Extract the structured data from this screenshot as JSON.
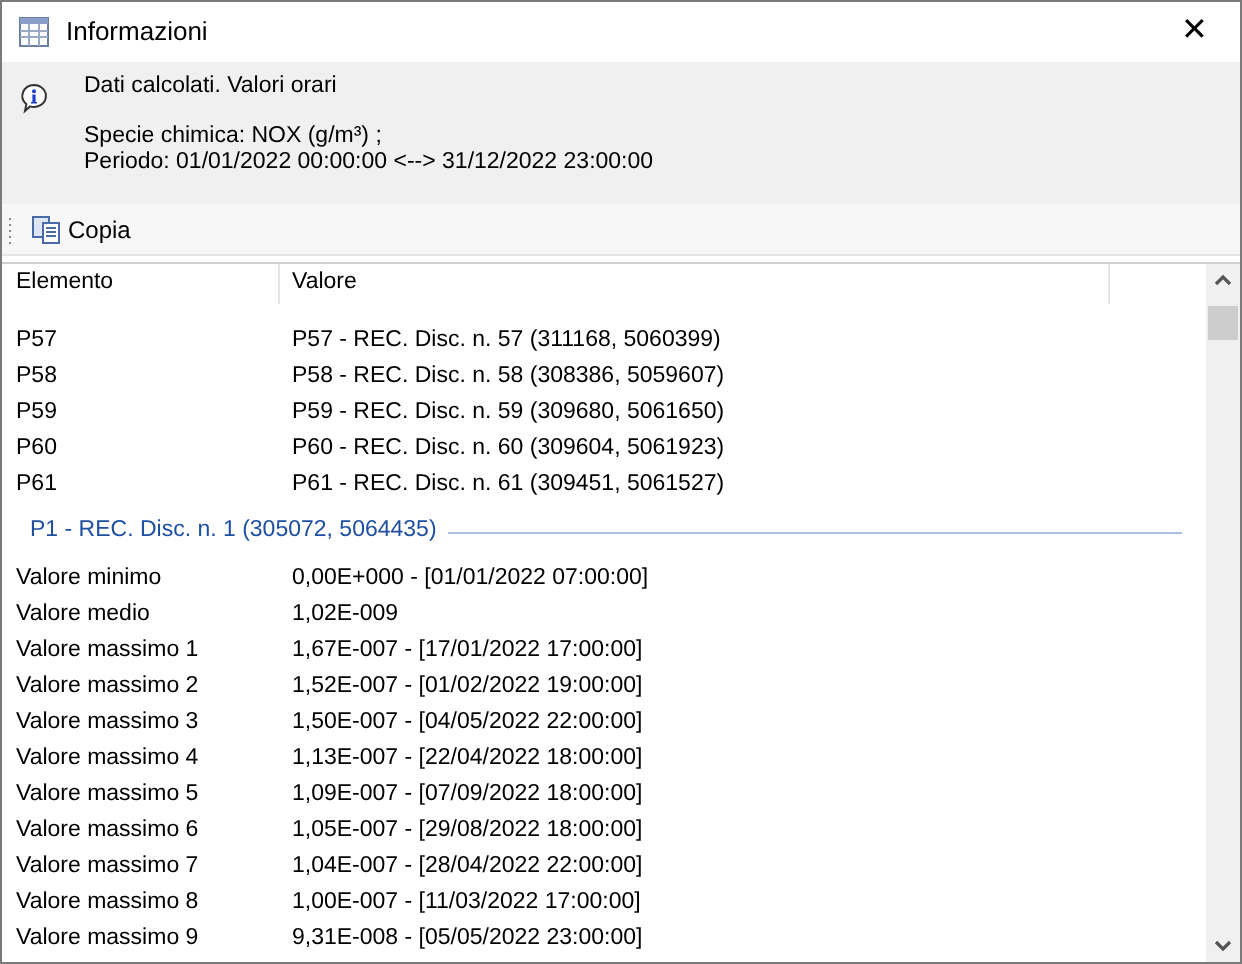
{
  "window": {
    "title": "Informazioni",
    "close": "✕"
  },
  "info": {
    "line1": "Dati calcolati. Valori orari",
    "line2": "Specie chimica: NOX (g/m³) ;",
    "line3": "Periodo: 01/01/2022 00:00:00 <--> 31/12/2022 23:00:00"
  },
  "toolbar": {
    "buttons": [
      "Copia"
    ]
  },
  "table": {
    "columns": [
      "Elemento",
      "Valore"
    ],
    "rows": [
      {
        "kind": "row",
        "cells": [
          "P57",
          "P57 - REC. Disc. n. 57 (311168, 5060399)"
        ]
      },
      {
        "kind": "row",
        "cells": [
          "P58",
          "P58 - REC. Disc. n. 58 (308386, 5059607)"
        ]
      },
      {
        "kind": "row",
        "cells": [
          "P59",
          "P59 - REC. Disc. n. 59 (309680, 5061650)"
        ]
      },
      {
        "kind": "row",
        "cells": [
          "P60",
          "P60 - REC. Disc. n. 60 (309604, 5061923)"
        ]
      },
      {
        "kind": "row",
        "cells": [
          "P61",
          "P61 - REC. Disc. n. 61 (309451, 5061527)"
        ]
      },
      {
        "kind": "group",
        "label": "P1 - REC. Disc. n. 1 (305072, 5064435)"
      },
      {
        "kind": "row",
        "cells": [
          "Valore minimo",
          "0,00E+000 - [01/01/2022 07:00:00]"
        ]
      },
      {
        "kind": "row",
        "cells": [
          "Valore medio",
          "1,02E-009"
        ]
      },
      {
        "kind": "row",
        "cells": [
          "Valore massimo 1",
          "1,67E-007 - [17/01/2022 17:00:00]"
        ]
      },
      {
        "kind": "row",
        "cells": [
          "Valore massimo 2",
          "1,52E-007 - [01/02/2022 19:00:00]"
        ]
      },
      {
        "kind": "row",
        "cells": [
          "Valore massimo 3",
          "1,50E-007 - [04/05/2022 22:00:00]"
        ]
      },
      {
        "kind": "row",
        "cells": [
          "Valore massimo 4",
          "1,13E-007 - [22/04/2022 18:00:00]"
        ]
      },
      {
        "kind": "row",
        "cells": [
          "Valore massimo 5",
          "1,09E-007 - [07/09/2022 18:00:00]"
        ]
      },
      {
        "kind": "row",
        "cells": [
          "Valore massimo 6",
          "1,05E-007 - [29/08/2022 18:00:00]"
        ]
      },
      {
        "kind": "row",
        "cells": [
          "Valore massimo 7",
          "1,04E-007 - [28/04/2022 22:00:00]"
        ]
      },
      {
        "kind": "row",
        "cells": [
          "Valore massimo 8",
          "1,00E-007 - [11/03/2022 17:00:00]"
        ]
      },
      {
        "kind": "row",
        "cells": [
          "Valore massimo 9",
          "9,31E-008 - [05/05/2022 23:00:00]"
        ]
      }
    ]
  }
}
